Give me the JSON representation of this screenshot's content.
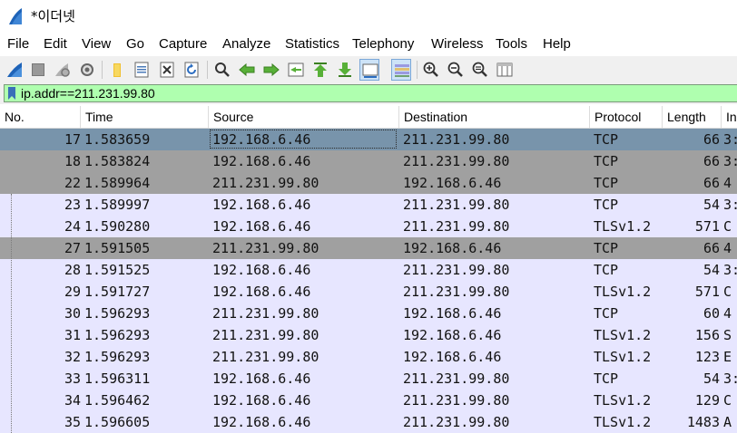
{
  "window": {
    "title": "*이더넷",
    "app_icon": "wireshark-fin-icon"
  },
  "menu": [
    "File",
    "Edit",
    "View",
    "Go",
    "Capture",
    "Analyze",
    "Statistics",
    "Telephony",
    "Wireless",
    "Tools",
    "Help"
  ],
  "toolbar": {
    "buttons": [
      "start-capture-icon",
      "stop-capture-icon",
      "restart-capture-icon",
      "capture-options-icon",
      "open-file-icon",
      "save-file-icon",
      "close-file-icon",
      "reload-file-icon",
      "find-packet-icon",
      "go-back-icon",
      "go-forward-icon",
      "go-to-packet-icon",
      "first-packet-icon",
      "last-packet-icon",
      "autoscroll-icon",
      "colorize-icon",
      "zoom-in-icon",
      "zoom-out-icon",
      "zoom-normal-icon",
      "resize-columns-icon"
    ]
  },
  "filter": {
    "value": "ip.addr==211.231.99.80",
    "bookmark_icon": "bookmark-icon"
  },
  "columns": [
    "No.",
    "Time",
    "Source",
    "Destination",
    "Protocol",
    "Length",
    "In"
  ],
  "colors": {
    "row_light": "#e7e6ff",
    "row_gray": "#a0a0a0",
    "row_selected": "#7894ab",
    "filter_bg": "#afffaf"
  },
  "packets": [
    {
      "no": "17",
      "time": "1.583659",
      "src": "192.168.6.46",
      "dst": "211.231.99.80",
      "proto": "TCP",
      "len": "66",
      "info": "3:",
      "style": "selected"
    },
    {
      "no": "18",
      "time": "1.583824",
      "src": "192.168.6.46",
      "dst": "211.231.99.80",
      "proto": "TCP",
      "len": "66",
      "info": "3:",
      "style": "gray"
    },
    {
      "no": "22",
      "time": "1.589964",
      "src": "211.231.99.80",
      "dst": "192.168.6.46",
      "proto": "TCP",
      "len": "66",
      "info": "4",
      "style": "gray"
    },
    {
      "no": "23",
      "time": "1.589997",
      "src": "192.168.6.46",
      "dst": "211.231.99.80",
      "proto": "TCP",
      "len": "54",
      "info": "3:",
      "style": "light"
    },
    {
      "no": "24",
      "time": "1.590280",
      "src": "192.168.6.46",
      "dst": "211.231.99.80",
      "proto": "TLSv1.2",
      "len": "571",
      "info": "C",
      "style": "light"
    },
    {
      "no": "27",
      "time": "1.591505",
      "src": "211.231.99.80",
      "dst": "192.168.6.46",
      "proto": "TCP",
      "len": "66",
      "info": "4",
      "style": "gray"
    },
    {
      "no": "28",
      "time": "1.591525",
      "src": "192.168.6.46",
      "dst": "211.231.99.80",
      "proto": "TCP",
      "len": "54",
      "info": "3:",
      "style": "light"
    },
    {
      "no": "29",
      "time": "1.591727",
      "src": "192.168.6.46",
      "dst": "211.231.99.80",
      "proto": "TLSv1.2",
      "len": "571",
      "info": "C",
      "style": "light"
    },
    {
      "no": "30",
      "time": "1.596293",
      "src": "211.231.99.80",
      "dst": "192.168.6.46",
      "proto": "TCP",
      "len": "60",
      "info": "4",
      "style": "light"
    },
    {
      "no": "31",
      "time": "1.596293",
      "src": "211.231.99.80",
      "dst": "192.168.6.46",
      "proto": "TLSv1.2",
      "len": "156",
      "info": "S",
      "style": "light"
    },
    {
      "no": "32",
      "time": "1.596293",
      "src": "211.231.99.80",
      "dst": "192.168.6.46",
      "proto": "TLSv1.2",
      "len": "123",
      "info": "E",
      "style": "light"
    },
    {
      "no": "33",
      "time": "1.596311",
      "src": "192.168.6.46",
      "dst": "211.231.99.80",
      "proto": "TCP",
      "len": "54",
      "info": "3:",
      "style": "light"
    },
    {
      "no": "34",
      "time": "1.596462",
      "src": "192.168.6.46",
      "dst": "211.231.99.80",
      "proto": "TLSv1.2",
      "len": "129",
      "info": "C",
      "style": "light"
    },
    {
      "no": "35",
      "time": "1.596605",
      "src": "192.168.6.46",
      "dst": "211.231.99.80",
      "proto": "TLSv1.2",
      "len": "1483",
      "info": "A",
      "style": "light"
    }
  ]
}
